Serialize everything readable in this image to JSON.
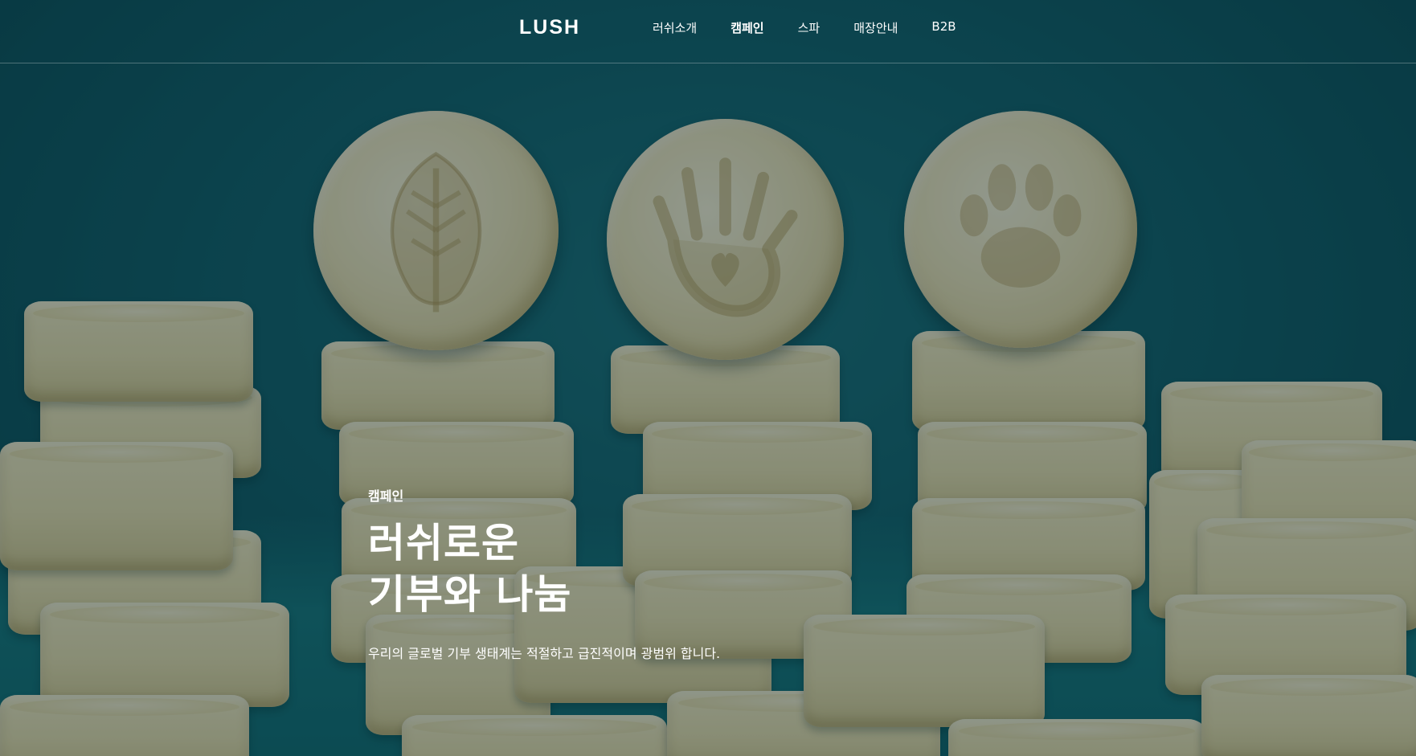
{
  "header": {
    "logo": "LUSH",
    "nav": [
      {
        "label": "러쉬소개",
        "active": false
      },
      {
        "label": "캠페인",
        "active": true
      },
      {
        "label": "스파",
        "active": false
      },
      {
        "label": "매장안내",
        "active": false
      },
      {
        "label": "B2B",
        "active": false
      }
    ]
  },
  "hero": {
    "eyebrow": "캠페인",
    "title_line1": "러쉬로운",
    "title_line2": "기부와 나눔",
    "description": "우리의 글로벌 기부 생태계는 적절하고 급진적이며 광범위 합니다."
  },
  "background": {
    "image": "stacks of cream-colored round soap bars on teal background",
    "coin_icons": [
      "leaf-icon",
      "hand-heart-icon",
      "paw-icon"
    ],
    "colors": {
      "teal": "#156470",
      "cream": "#f1e7be",
      "overlay": "#00181e"
    }
  }
}
